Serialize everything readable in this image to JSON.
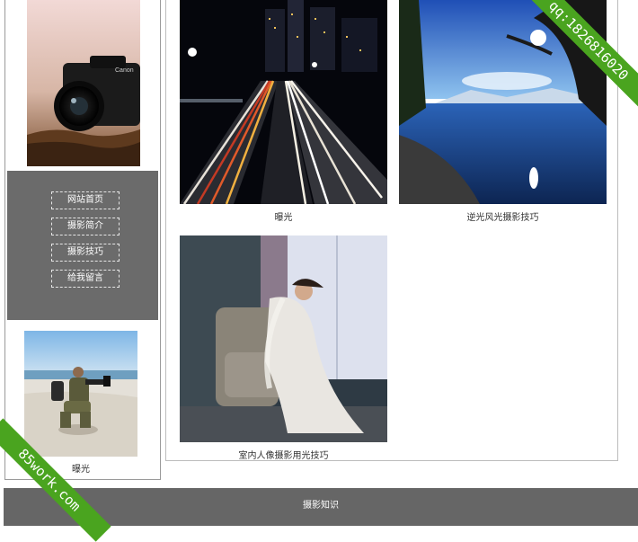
{
  "nav": {
    "items": [
      {
        "label": "网站首页"
      },
      {
        "label": "摄影简介"
      },
      {
        "label": "摄影技巧"
      },
      {
        "label": "给我留言"
      }
    ]
  },
  "sidebar": {
    "thumb_caption": "曝光"
  },
  "gallery": {
    "items": [
      {
        "caption": "曝光"
      },
      {
        "caption": "逆光风光摄影技巧"
      },
      {
        "caption": "室内人像摄影用光技巧"
      }
    ]
  },
  "footer": {
    "label": "摄影知识"
  },
  "watermarks": {
    "top_right": "qq:1826816020",
    "bottom_left": "85work.com"
  },
  "colors": {
    "nav_bg": "#6b6b6b",
    "footer_bg": "#666666",
    "ribbon": "#4aa41f"
  }
}
